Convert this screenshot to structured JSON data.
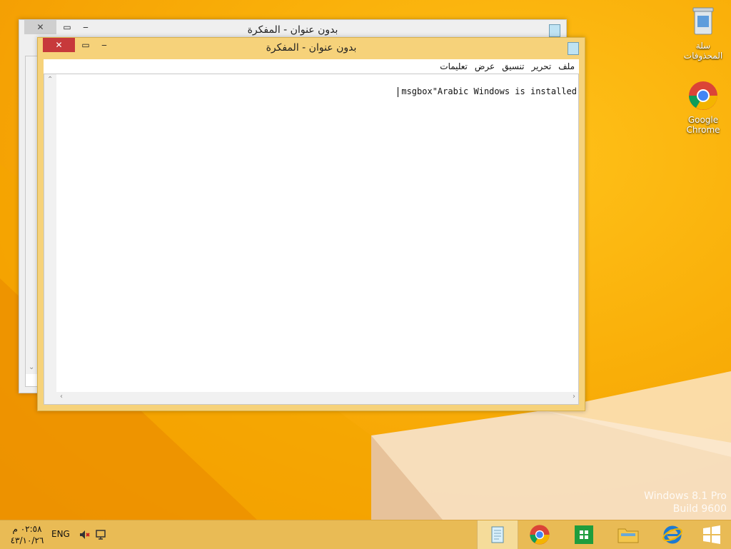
{
  "desktop": {
    "icons": [
      {
        "name": "recycle-bin",
        "label": "سلة المحذوفات"
      },
      {
        "name": "google-chrome",
        "label": "Google Chrome"
      }
    ],
    "watermark": {
      "line1": "Windows 8.1 Pro",
      "line2": "Build 9600"
    }
  },
  "windows": {
    "back": {
      "title": "بدون عنوان - المفكرة"
    },
    "front": {
      "title": "بدون عنوان - المفكرة",
      "menu": [
        "ملف",
        "تحرير",
        "تنسيق",
        "عرض",
        "تعليمات"
      ],
      "text": "msgbox\"Arabic Windows is installed"
    }
  },
  "taskbar": {
    "clock_time": "٠٢:٥٨ م",
    "clock_date": "٤٣/١٠/٢٦",
    "language": "ENG",
    "apps": [
      "notepad",
      "chrome",
      "store",
      "file-explorer",
      "internet-explorer"
    ]
  },
  "colors": {
    "accent": "#f6a000",
    "active_title": "#f6d27a",
    "close_button": "#c7393b"
  }
}
